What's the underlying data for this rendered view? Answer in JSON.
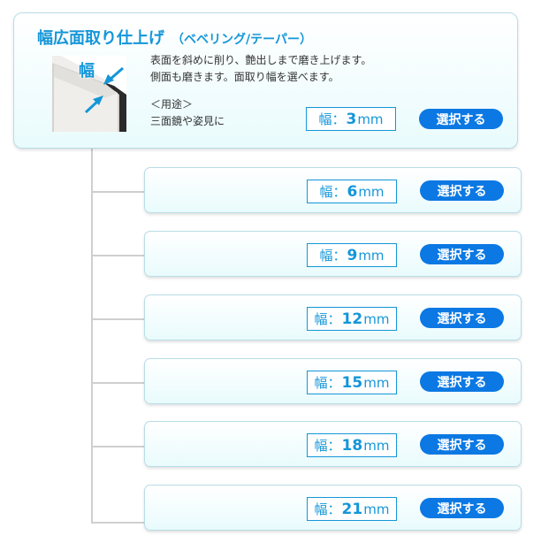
{
  "main": {
    "title": "幅広面取り仕上げ",
    "subtitle": "（ベベリング/テーパー）",
    "image_label": "幅",
    "description": [
      "表面を斜めに削り、艶出しまで磨き上げます。",
      "側面も磨きます。面取り幅を選べます。"
    ],
    "usage_heading": "＜用途＞",
    "usage_text": "三面鏡や姿見に",
    "width_prefix": "幅：",
    "width_value": "3",
    "width_unit": "mm",
    "button_label": "選択する"
  },
  "options": [
    {
      "width_prefix": "幅：",
      "width_value": "6",
      "width_unit": "mm",
      "button_label": "選択する"
    },
    {
      "width_prefix": "幅：",
      "width_value": "9",
      "width_unit": "mm",
      "button_label": "選択する"
    },
    {
      "width_prefix": "幅：",
      "width_value": "12",
      "width_unit": "mm",
      "button_label": "選択する"
    },
    {
      "width_prefix": "幅：",
      "width_value": "15",
      "width_unit": "mm",
      "button_label": "選択する"
    },
    {
      "width_prefix": "幅：",
      "width_value": "18",
      "width_unit": "mm",
      "button_label": "選択する"
    },
    {
      "width_prefix": "幅：",
      "width_value": "21",
      "width_unit": "mm",
      "button_label": "選択する"
    }
  ],
  "colors": {
    "accent": "#1496d8",
    "button": "#0b78e3",
    "card_bg": "#e9fbfd",
    "card_border": "#b8dde6",
    "tree_line": "#cfcfcf"
  },
  "icons": [
    "arrow-icon"
  ]
}
